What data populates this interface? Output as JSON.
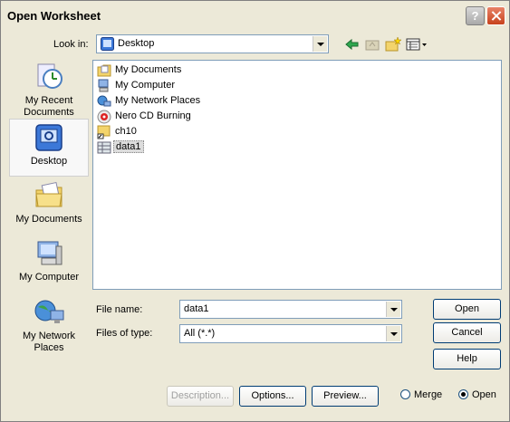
{
  "window": {
    "title": "Open Worksheet",
    "help_glyph": "?"
  },
  "lookin": {
    "label": "Look in:",
    "value": "Desktop"
  },
  "toolbar": {
    "icons": [
      "back-icon",
      "up-folder-icon",
      "new-folder-icon",
      "views-menu-icon"
    ]
  },
  "places": [
    {
      "label": "My Recent Documents",
      "icon": "recent-documents-icon"
    },
    {
      "label": "Desktop",
      "icon": "desktop-icon",
      "selected": true
    },
    {
      "label": "My Documents",
      "icon": "my-documents-icon"
    },
    {
      "label": "My Computer",
      "icon": "my-computer-icon"
    },
    {
      "label": "My Network Places",
      "icon": "network-places-icon"
    }
  ],
  "files": [
    {
      "name": "My Documents",
      "icon": "folder-docs-icon"
    },
    {
      "name": "My Computer",
      "icon": "computer-icon"
    },
    {
      "name": "My Network Places",
      "icon": "network-icon"
    },
    {
      "name": "Nero CD Burning",
      "icon": "cd-burn-icon"
    },
    {
      "name": "ch10",
      "icon": "shortcut-icon"
    },
    {
      "name": "data1",
      "icon": "worksheet-icon",
      "selected": true
    }
  ],
  "form": {
    "file_name_label": "File name:",
    "file_name_value": "data1",
    "file_type_label": "Files of type:",
    "file_type_value": "All (*.*)"
  },
  "buttons": {
    "open": "Open",
    "cancel": "Cancel",
    "help": "Help",
    "description": "Description...",
    "options": "Options...",
    "preview": "Preview..."
  },
  "radios": {
    "merge": "Merge",
    "open": "Open",
    "selected": "open"
  }
}
